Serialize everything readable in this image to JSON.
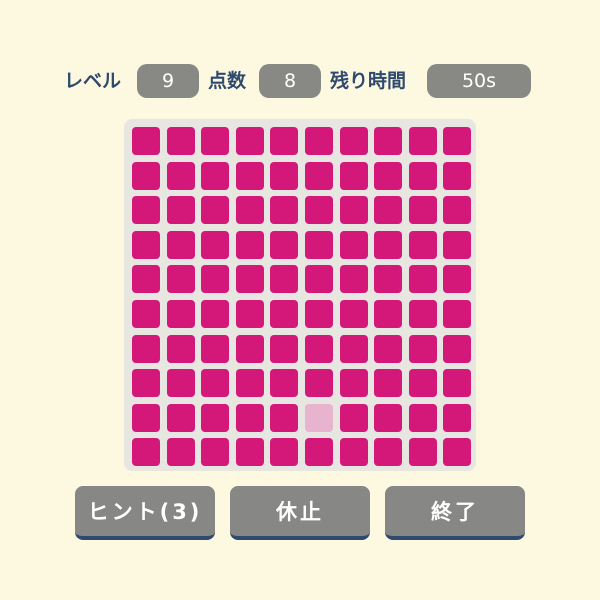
{
  "hud": {
    "level_label": "レベル",
    "level_value": "9",
    "score_label": "点数",
    "score_value": "8",
    "time_label": "残り時間",
    "time_value": "50s"
  },
  "board": {
    "rows": 10,
    "cols": 10,
    "odd_cell": {
      "row": 8,
      "col": 5
    },
    "tile_color": "#d4187a",
    "odd_tile_color": "#e7b3cf"
  },
  "buttons": {
    "hint_label": "ヒント(3)",
    "pause_label": "休止",
    "quit_label": "終了"
  },
  "colors": {
    "background": "#fdf9e1",
    "label_text": "#2f4a6e",
    "pill_background": "#888885",
    "button_background": "#878786",
    "button_shadow": "#2f4a6e"
  }
}
